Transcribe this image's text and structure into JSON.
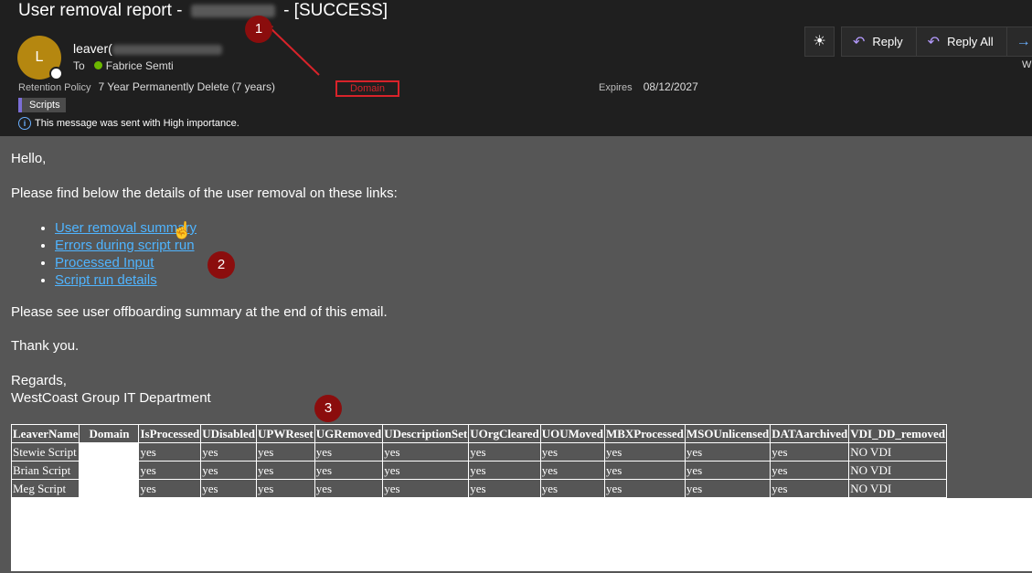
{
  "header": {
    "subject_prefix": "User removal report -",
    "subject_suffix": "-  [SUCCESS]",
    "avatar_initial": "L",
    "sender": "leaver(",
    "to_label": "To",
    "recipient": "Fabrice Semti",
    "retention_label": "Retention Policy",
    "retention_value": "7 Year Permanently Delete (7 years)",
    "domain_label": "Domain",
    "expires_label": "Expires",
    "expires_value": "08/12/2027",
    "category": "Scripts",
    "importance": "This message was sent with High importance.",
    "w_text": "W"
  },
  "toolbar": {
    "reply": "Reply",
    "reply_all": "Reply All"
  },
  "annotations": {
    "m1": "1",
    "m2": "2",
    "m3": "3"
  },
  "body": {
    "greeting": "Hello,",
    "intro": "Please find below the details of the user removal on these links:",
    "links": [
      "User removal summary",
      "Errors during script run",
      "Processed Input",
      "Script run details"
    ],
    "offboarding": "Please see user offboarding summary at the end of this email.",
    "thanks": "Thank you.",
    "regards": "Regards,",
    "signature": "WestCoast Group IT Department"
  },
  "table": {
    "headers": [
      "LeaverName",
      "Domain",
      "IsProcessed",
      "UDisabled",
      "UPWReset",
      "UGRemoved",
      "UDescriptionSet",
      "UOrgCleared",
      "UOUMoved",
      "MBXProcessed",
      "MSOUnlicensed",
      "DATAarchived",
      "VDI_DD_removed"
    ],
    "rows": [
      [
        "Stewie Script",
        "",
        "yes",
        "yes",
        "yes",
        "yes",
        "yes",
        "yes",
        "yes",
        "yes",
        "yes",
        "yes",
        "NO VDI"
      ],
      [
        "Brian Script",
        "",
        "yes",
        "yes",
        "yes",
        "yes",
        "yes",
        "yes",
        "yes",
        "yes",
        "yes",
        "yes",
        "NO VDI"
      ],
      [
        "Meg Script",
        "",
        "yes",
        "yes",
        "yes",
        "yes",
        "yes",
        "yes",
        "yes",
        "yes",
        "yes",
        "yes",
        "NO VDI"
      ]
    ]
  },
  "colors": {
    "link": "#4fb4ff",
    "marker": "#8b0d0d",
    "highlight": "#d8232a",
    "avatar": "#b58710"
  }
}
